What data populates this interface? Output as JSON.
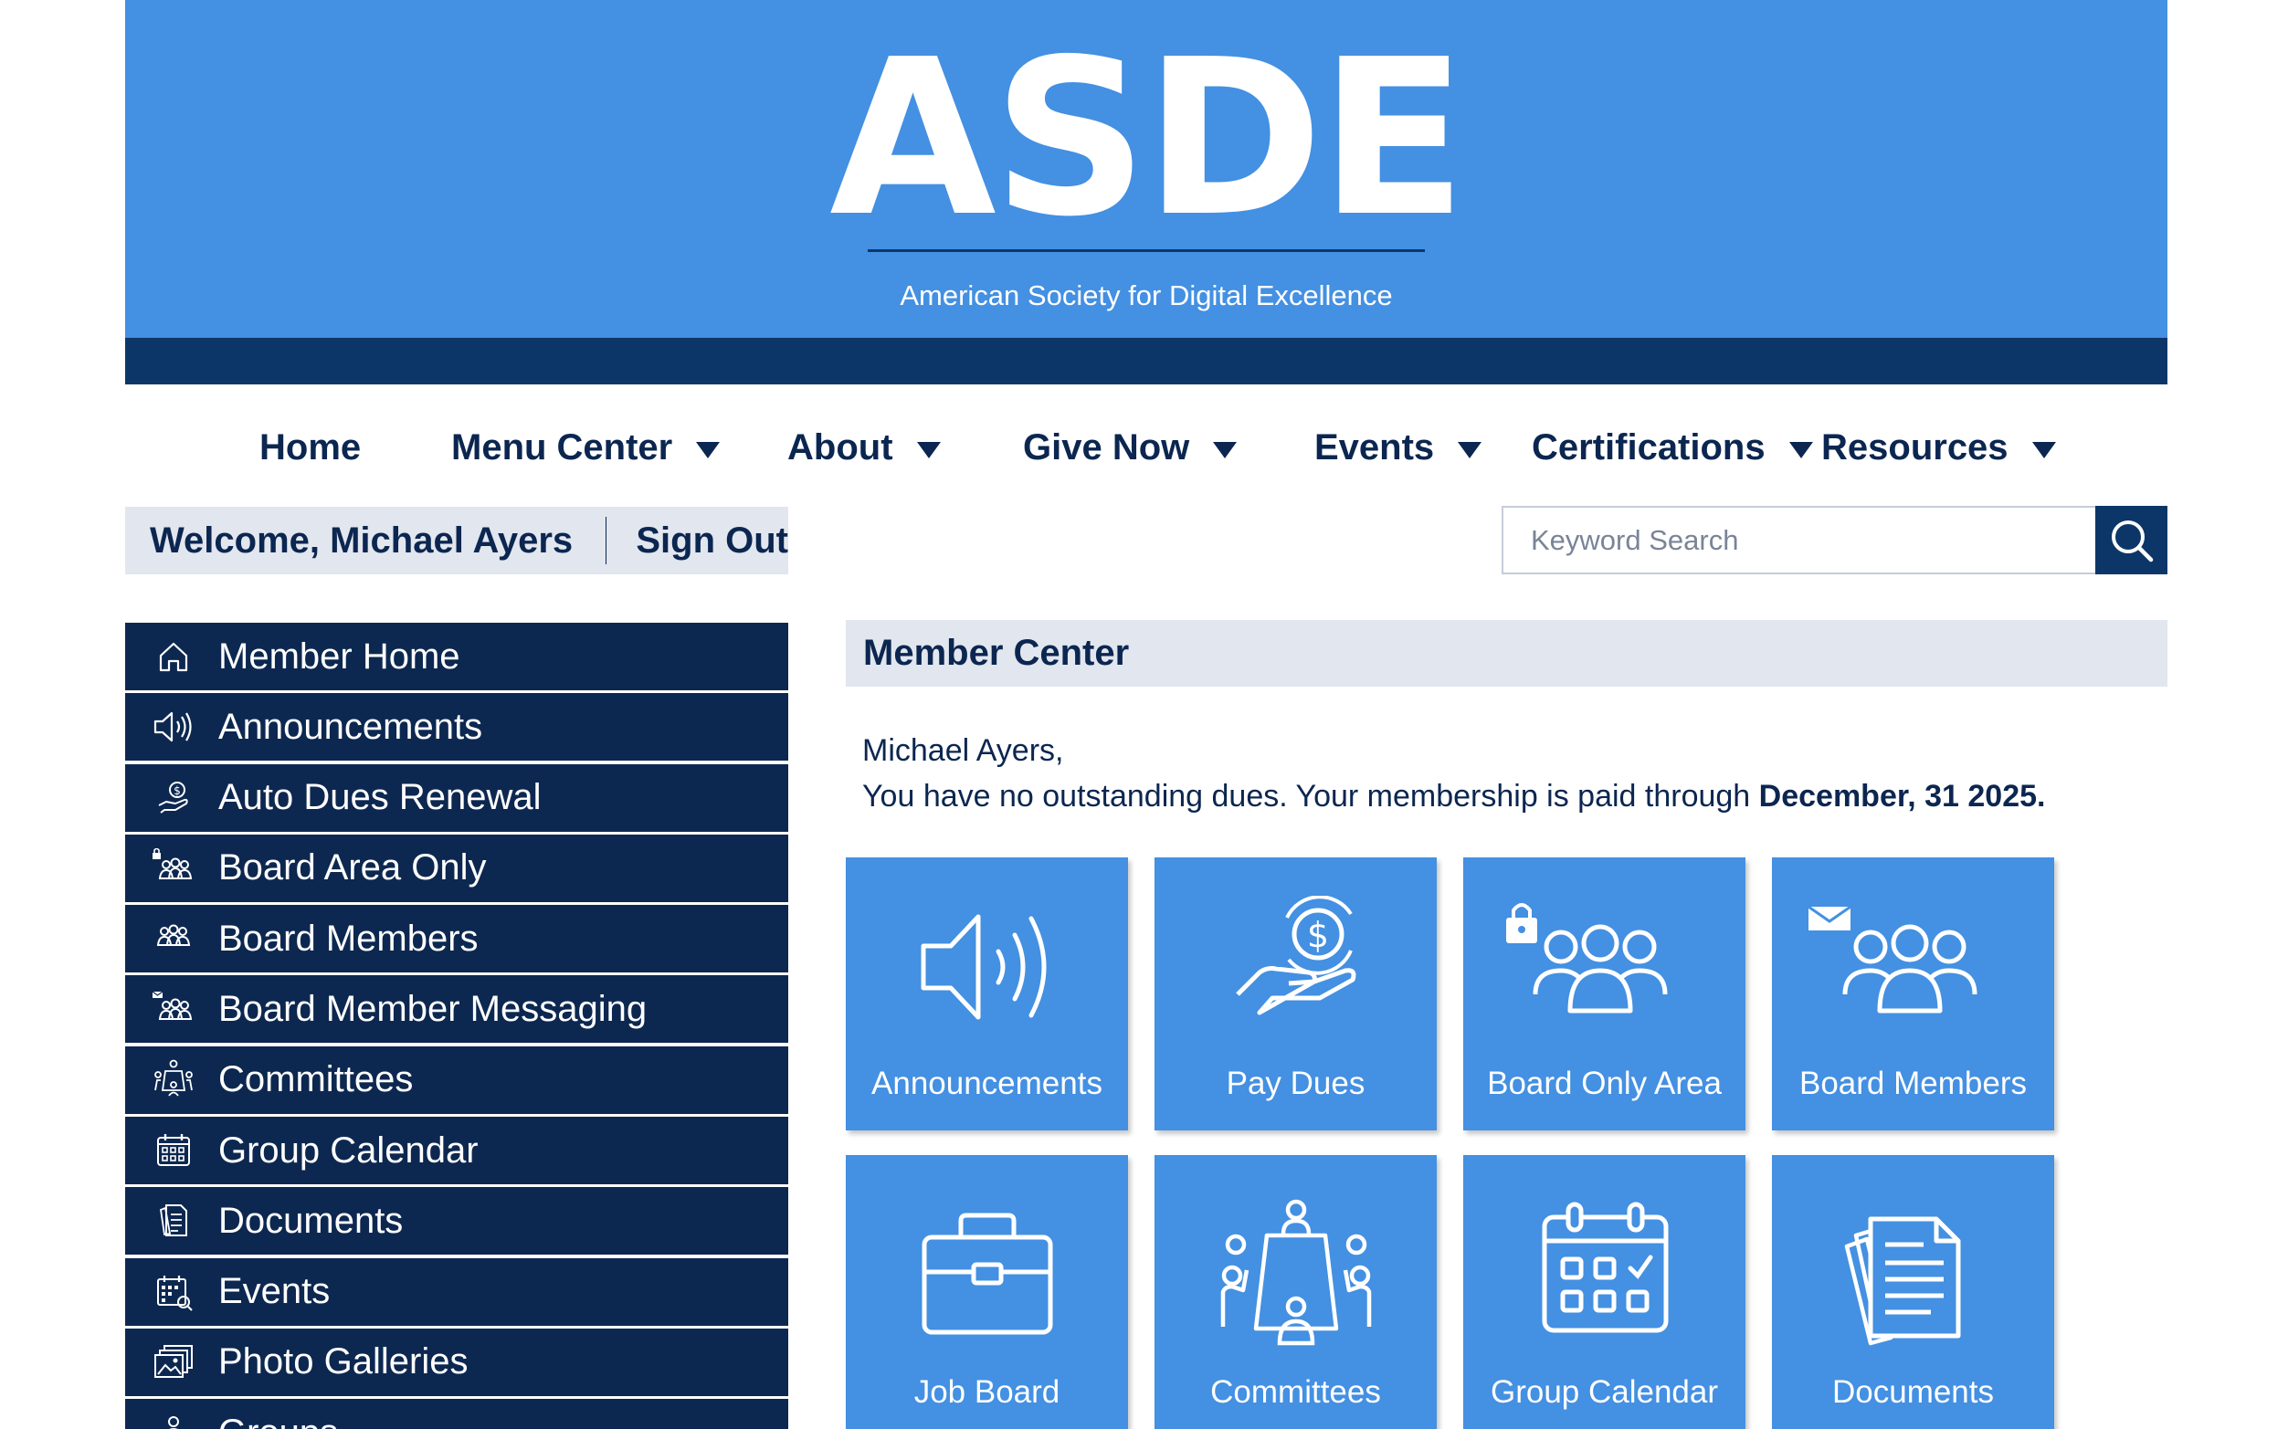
{
  "header": {
    "logo_text": "ASDE",
    "tagline": "American Society for Digital Excellence",
    "colors": {
      "banner": "#4490e2",
      "banner_bar": "#0d3668",
      "sidebar": "#0d2850",
      "tile": "#4490e2",
      "panel_header": "#e2e6ee"
    }
  },
  "nav": {
    "items": [
      {
        "label": "Home",
        "dropdown": false
      },
      {
        "label": "Menu Center",
        "dropdown": true
      },
      {
        "label": "About",
        "dropdown": true
      },
      {
        "label": "Give Now",
        "dropdown": true
      },
      {
        "label": "Events",
        "dropdown": true
      },
      {
        "label": "Certifications",
        "dropdown": true
      },
      {
        "label": "Resources",
        "dropdown": true
      }
    ]
  },
  "welcome": {
    "text": "Welcome, Michael Ayers",
    "signout": "Sign Out"
  },
  "search": {
    "placeholder": "Keyword Search",
    "icon": "search-icon"
  },
  "sidebar": {
    "items": [
      {
        "label": "Member Home",
        "icon": "home-icon"
      },
      {
        "label": "Announcements",
        "icon": "megaphone-icon"
      },
      {
        "label": "Auto Dues Renewal",
        "icon": "hand-dollar-icon"
      },
      {
        "label": "Board Area Only",
        "icon": "locked-group-icon"
      },
      {
        "label": "Board Members",
        "icon": "group-icon"
      },
      {
        "label": "Board Member Messaging",
        "icon": "group-message-icon"
      },
      {
        "label": "Committees",
        "icon": "committee-icon"
      },
      {
        "label": "Group Calendar",
        "icon": "calendar-icon"
      },
      {
        "label": "Documents",
        "icon": "documents-icon"
      },
      {
        "label": "Events",
        "icon": "events-calendar-icon"
      },
      {
        "label": "Photo Galleries",
        "icon": "photo-gallery-icon"
      },
      {
        "label": "Groups",
        "icon": "groups-icon"
      }
    ]
  },
  "main": {
    "title": "Member Center",
    "greeting_name": "Michael Ayers,",
    "dues_text": "You have no outstanding dues. Your membership is paid through ",
    "dues_date": "December, 31 2025.",
    "tiles": [
      {
        "label": "Announcements",
        "icon": "megaphone-icon"
      },
      {
        "label": "Pay Dues",
        "icon": "hand-dollar-icon"
      },
      {
        "label": "Board Only Area",
        "icon": "locked-group-icon"
      },
      {
        "label": "Board Members",
        "icon": "group-message-icon"
      },
      {
        "label": "Job Board",
        "icon": "briefcase-icon"
      },
      {
        "label": "Committees",
        "icon": "committee-icon"
      },
      {
        "label": "Group Calendar",
        "icon": "calendar-icon"
      },
      {
        "label": "Documents",
        "icon": "documents-icon"
      }
    ]
  }
}
